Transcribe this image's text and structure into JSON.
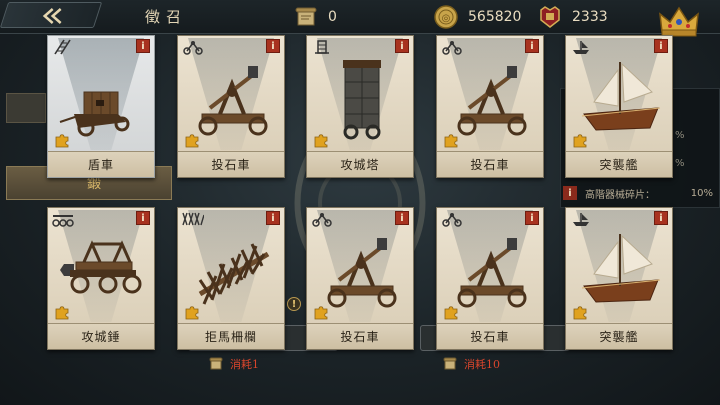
{
  "header": {
    "title": "徵召",
    "scrolls": "0",
    "gold": "565820",
    "crest_points": "2333"
  },
  "background": {
    "left_tab_label": "鍛",
    "right_info_label": "高階器械碎片：",
    "right_info_pct": "10%",
    "pct_stub_1": "%",
    "pct_stub_2": "%",
    "cost_left": "消耗1",
    "cost_right": "消耗10",
    "warn_mark": "!"
  },
  "cards": [
    {
      "name": "盾車",
      "icon": "ladder-icon",
      "machine": "mantlet-cart",
      "selected": true
    },
    {
      "name": "投石車",
      "icon": "catapult-icon",
      "machine": "catapult",
      "selected": false
    },
    {
      "name": "攻城塔",
      "icon": "tower-icon",
      "machine": "siege-tower",
      "selected": false
    },
    {
      "name": "投石車",
      "icon": "catapult-icon",
      "machine": "catapult",
      "selected": false
    },
    {
      "name": "突襲艦",
      "icon": "ship-icon",
      "machine": "sailing-ship",
      "selected": false
    },
    {
      "name": "攻城錘",
      "icon": "ram-icon",
      "machine": "battering-ram",
      "selected": false
    },
    {
      "name": "拒馬柵欄",
      "icon": "spikes-icon",
      "machine": "cheval-de-frise",
      "selected": false
    },
    {
      "name": "投石車",
      "icon": "catapult-icon",
      "machine": "catapult",
      "selected": false
    },
    {
      "name": "投石車",
      "icon": "catapult-icon",
      "machine": "catapult",
      "selected": false
    },
    {
      "name": "突襲艦",
      "icon": "ship-icon",
      "machine": "sailing-ship",
      "selected": false
    }
  ],
  "info_label": "i"
}
